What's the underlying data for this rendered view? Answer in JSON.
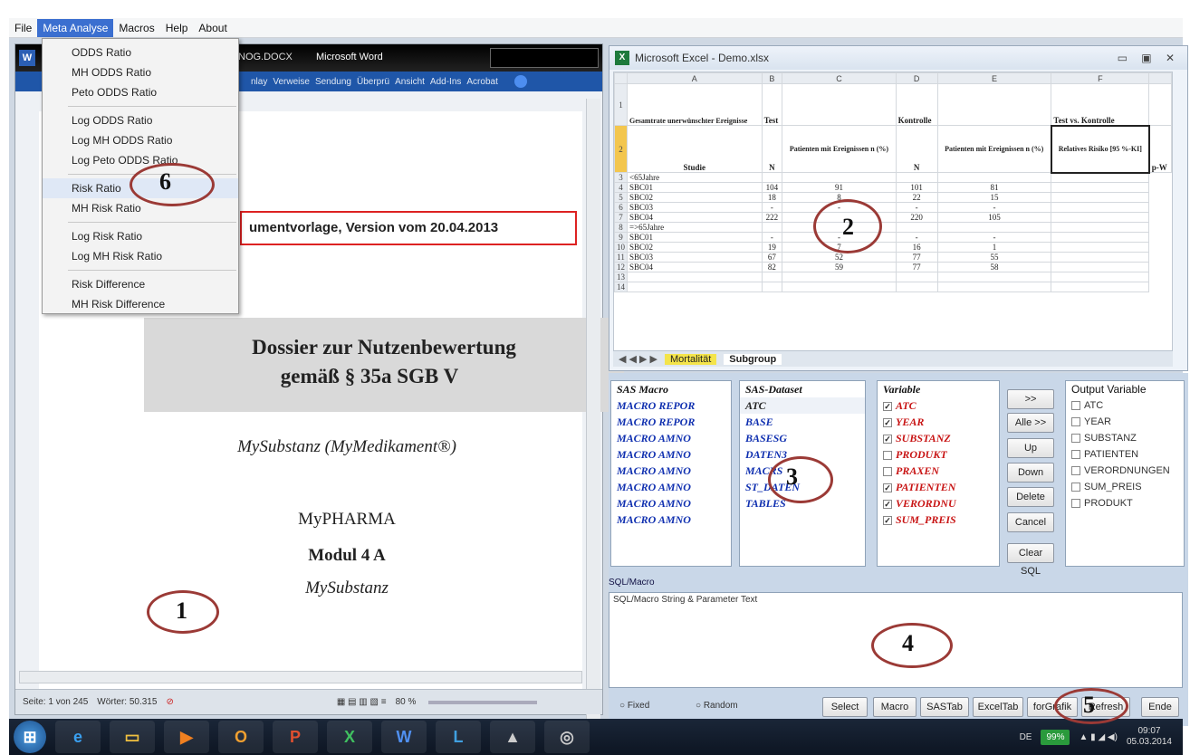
{
  "menubar": {
    "items": [
      "File",
      "Meta Analyse",
      "Macros",
      "Help",
      "About"
    ],
    "active": "Meta Analyse"
  },
  "dropdown": {
    "groups": [
      [
        "ODDS Ratio",
        "MH ODDS Ratio",
        "Peto ODDS Ratio"
      ],
      [
        "Log ODDS Ratio",
        "Log MH ODDS Ratio",
        "Log Peto ODDS Ratio"
      ],
      [
        "Risk Ratio",
        "MH Risk Ratio"
      ],
      [
        "Log Risk Ratio",
        "Log MH Risk Ratio"
      ],
      [
        "Risk Difference",
        "MH Risk Difference"
      ]
    ],
    "highlighted": "Risk Ratio"
  },
  "word": {
    "title": "Microsoft Word",
    "doc_name": "NOG.DOCX",
    "ribbon_tabs": [
      "nlay",
      "Verweise",
      "Sendung",
      "Überprü",
      "Ansicht",
      "Add-Ins",
      "Acrobat"
    ],
    "doc_template_box": "umentvorlage, Version vom 20.04.2013",
    "dossier_title_1": "Dossier zur Nutzenbewertung",
    "dossier_title_2": "gemäß § 35a SGB V",
    "substance_line": "MySubstanz (MyMedikament®)",
    "company": "MyPHARMA",
    "module": "Modul 4 A",
    "module_sub": "MySubstanz",
    "status_page": "Seite: 1 von 245",
    "status_words": "Wörter: 50.315",
    "zoom": "80 %"
  },
  "excel": {
    "title": "Microsoft Excel - Demo.xlsx",
    "columns": [
      "A",
      "B",
      "C",
      "D",
      "E",
      "F"
    ],
    "header_row1": [
      "Gesamtrate unerwünschter Ereignisse",
      "Test",
      "",
      "Kontrolle",
      "",
      "Test vs. Kontrolle"
    ],
    "header_row2": [
      "Studie",
      "N",
      "Patienten mit Ereignissen n (%)",
      "N",
      "Patienten mit Ereignissen n (%)",
      "Relatives Risiko [95 %-KI]",
      "p-W"
    ],
    "rows": [
      [
        "3",
        "<65Jahre",
        "",
        "",
        "",
        "",
        ""
      ],
      [
        "4",
        "SBC01",
        "104",
        "91",
        "101",
        "81",
        ""
      ],
      [
        "5",
        "SBC02",
        "18",
        "8",
        "22",
        "15",
        ""
      ],
      [
        "6",
        "SBC03",
        "-",
        "-",
        "-",
        "-",
        ""
      ],
      [
        "7",
        "SBC04",
        "222",
        "",
        "220",
        "105",
        ""
      ],
      [
        "8",
        "=>65Jahre",
        "",
        "",
        "",
        "",
        ""
      ],
      [
        "9",
        "SBC01",
        "-",
        "-",
        "-",
        "-",
        ""
      ],
      [
        "10",
        "SBC02",
        "19",
        "7",
        "16",
        "1",
        ""
      ],
      [
        "11",
        "SBC03",
        "67",
        "52",
        "77",
        "55",
        ""
      ],
      [
        "12",
        "SBC04",
        "82",
        "59",
        "77",
        "58",
        ""
      ],
      [
        "13",
        "",
        "",
        "",
        "",
        "",
        ""
      ],
      [
        "14",
        "",
        "",
        "",
        "",
        "",
        ""
      ]
    ],
    "sheet_tabs": [
      "Mortalität",
      "Subgroup"
    ],
    "active_sheet": "Subgroup"
  },
  "sas": {
    "macro_header": "SAS Macro",
    "macros": [
      "MACRO REPOR",
      "MACRO REPOR",
      "MACRO AMNO",
      "MACRO AMNO",
      "MACRO AMNO",
      "MACRO AMNO",
      "MACRO AMNO",
      "MACRO AMNO"
    ],
    "dataset_header": "SAS-Dataset",
    "datasets": [
      "ATC",
      "BASE",
      "BASESG",
      "DATEN3",
      "MACRS",
      "ST_DATEN",
      "TABLES"
    ],
    "variable_header": "Variable",
    "variables": [
      {
        "name": "ATC",
        "checked": true
      },
      {
        "name": "YEAR",
        "checked": true
      },
      {
        "name": "SUBSTANZ",
        "checked": true
      },
      {
        "name": "PRODUKT",
        "checked": false
      },
      {
        "name": "PRAXEN",
        "checked": false
      },
      {
        "name": "PATIENTEN",
        "checked": true
      },
      {
        "name": "VERORDNU",
        "checked": true
      },
      {
        "name": "SUM_PREIS",
        "checked": true
      }
    ],
    "buttons": [
      ">>",
      "Alle >>",
      "Up",
      "Down",
      "Delete",
      "Cancel",
      "Clear SQL"
    ],
    "output_header": "Output Variable",
    "outputs": [
      "ATC",
      "YEAR",
      "SUBSTANZ",
      "PATIENTEN",
      "VERORDNUNGEN",
      "SUM_PREIS",
      "PRODUKT"
    ],
    "sql_label": "SQL/Macro",
    "sql_text": "SQL/Macro String & Parameter Text",
    "radio_fixed": "Fixed",
    "radio_random": "Random",
    "bottom_buttons": [
      "Select",
      "Macro",
      "SASTab",
      "ExcelTab",
      "forGrafik",
      "Refresh",
      "Ende"
    ]
  },
  "taskbar": {
    "lang": "DE",
    "battery": "99%",
    "time": "09:07",
    "date": "05.03.2014"
  },
  "annotations": [
    "1",
    "2",
    "3",
    "4",
    "5",
    "6"
  ]
}
